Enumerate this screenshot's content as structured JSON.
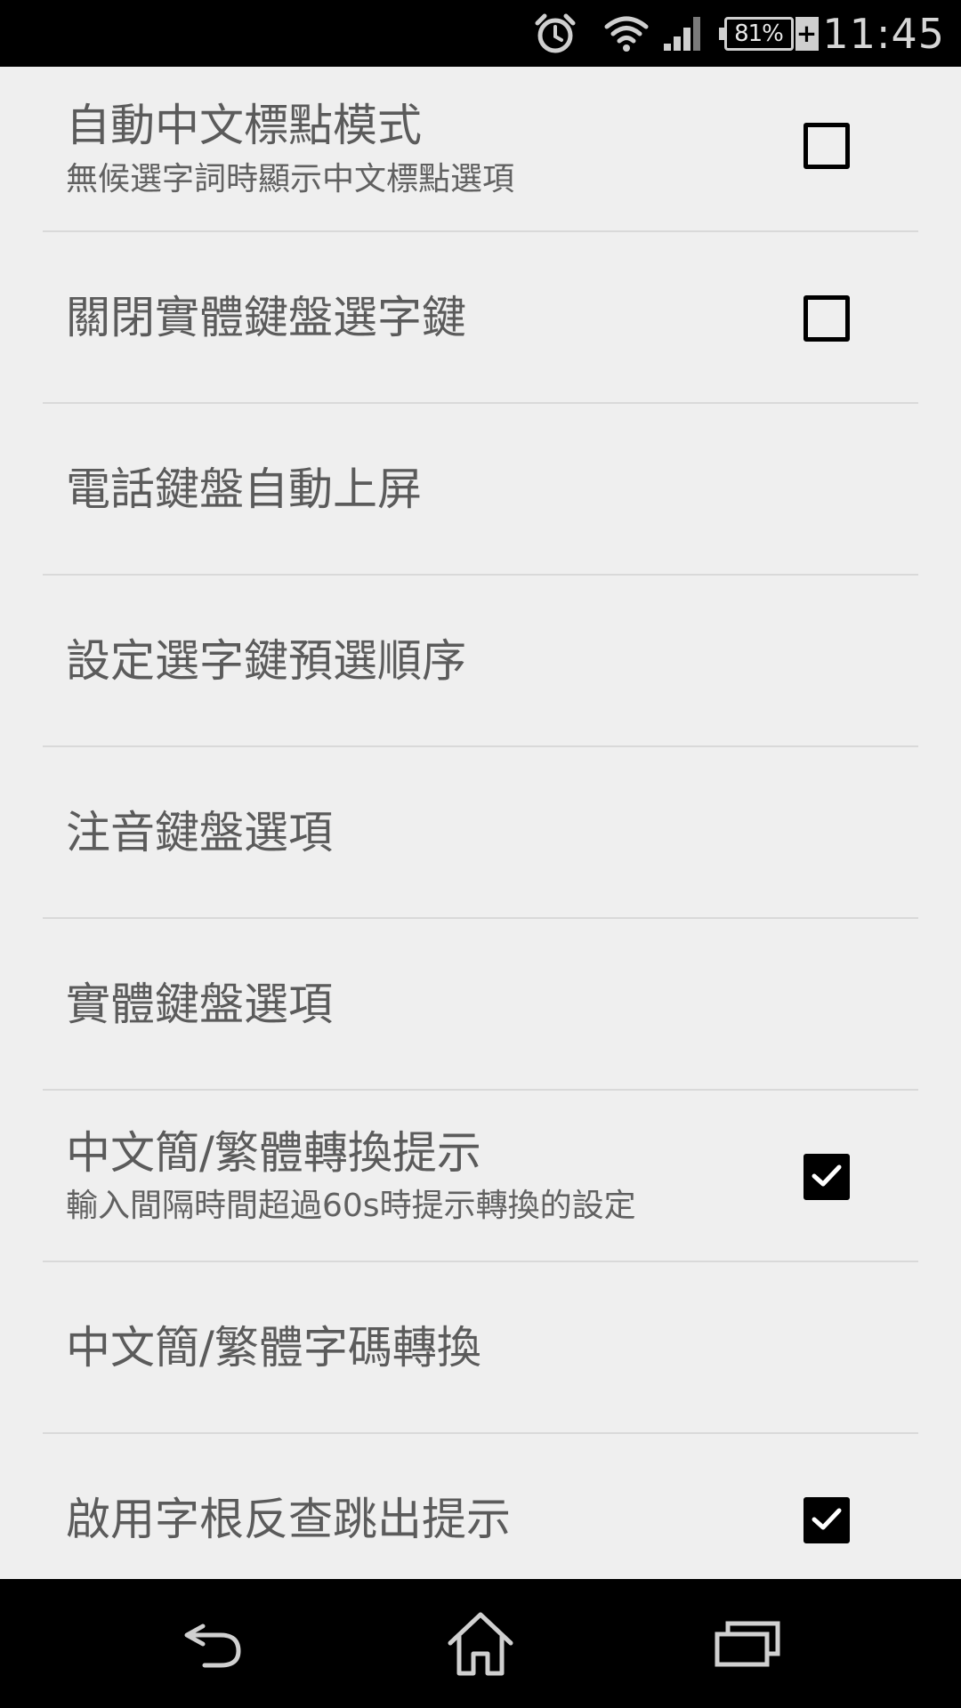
{
  "status_bar": {
    "battery_percent": "81%",
    "battery_charging_glyph": "+",
    "time": "11:45",
    "icons": [
      "alarm-icon",
      "wifi-icon",
      "signal-icon",
      "battery-icon"
    ]
  },
  "preferences": [
    {
      "title": "自動中文標點模式",
      "summary": "無候選字詞時顯示中文標點選項",
      "checkbox": true,
      "checked": false
    },
    {
      "title": "關閉實體鍵盤選字鍵",
      "summary": "",
      "checkbox": true,
      "checked": false
    },
    {
      "title": "電話鍵盤自動上屏",
      "summary": "",
      "checkbox": false,
      "checked": false
    },
    {
      "title": "設定選字鍵預選順序",
      "summary": "",
      "checkbox": false,
      "checked": false
    },
    {
      "title": "注音鍵盤選項",
      "summary": "",
      "checkbox": false,
      "checked": false
    },
    {
      "title": "實體鍵盤選項",
      "summary": "",
      "checkbox": false,
      "checked": false
    },
    {
      "title": "中文簡/繁體轉換提示",
      "summary": "輸入間隔時間超過60s時提示轉換的設定",
      "checkbox": true,
      "checked": true
    },
    {
      "title": "中文簡/繁體字碼轉換",
      "summary": "",
      "checkbox": false,
      "checked": false
    },
    {
      "title": "啟用字根反查跳出提示",
      "summary": "",
      "checkbox": true,
      "checked": true
    }
  ],
  "nav_bar": {
    "icons": [
      "back-icon",
      "home-icon",
      "recents-icon"
    ]
  },
  "colors": {
    "background": "#efefef",
    "title_text": "#5b5b5b",
    "summary_text": "#616161",
    "divider": "#d9d9d9",
    "bars": "#000000"
  }
}
